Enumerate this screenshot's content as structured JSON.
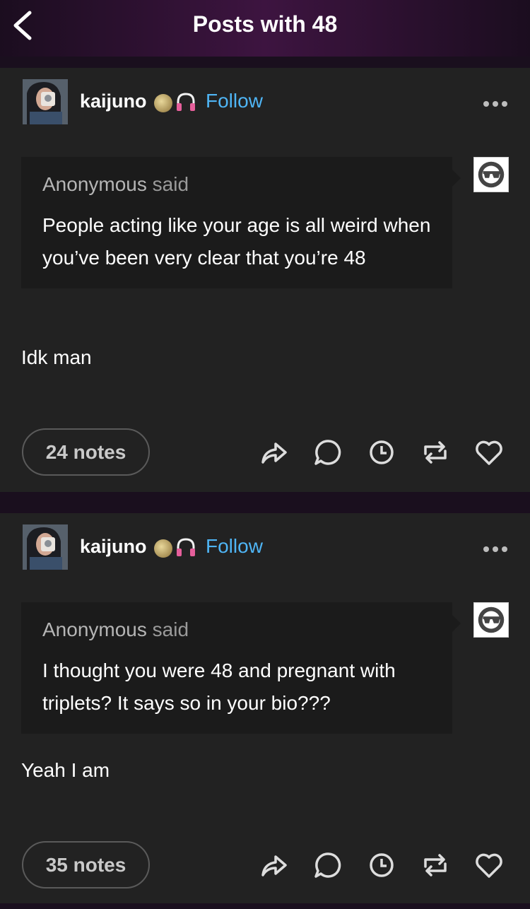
{
  "header": {
    "title": "Posts with 48",
    "back_icon": "chevron-left-icon"
  },
  "posts": [
    {
      "username": "kaijuno",
      "badges": [
        "moon-icon",
        "headphones-icon"
      ],
      "follow_label": "Follow",
      "asker_name": "Anonymous",
      "asker_said": "said",
      "question": "People acting like your age is all weird when you’ve been very clear that you’re 48",
      "answer": "Idk man",
      "notes": "24 notes"
    },
    {
      "username": "kaijuno",
      "badges": [
        "moon-icon",
        "headphones-icon"
      ],
      "follow_label": "Follow",
      "asker_name": "Anonymous",
      "asker_said": "said",
      "question": "I thought you were 48 and pregnant with triplets? It says so in your bio???",
      "answer": "Yeah I am",
      "notes": "35 notes"
    }
  ],
  "actions": [
    "share-icon",
    "reply-icon",
    "schedule-icon",
    "reblog-icon",
    "like-icon"
  ],
  "colors": {
    "accent": "#4fb5f5",
    "post_bg": "#222222",
    "ask_bg": "#1b1b1b"
  }
}
